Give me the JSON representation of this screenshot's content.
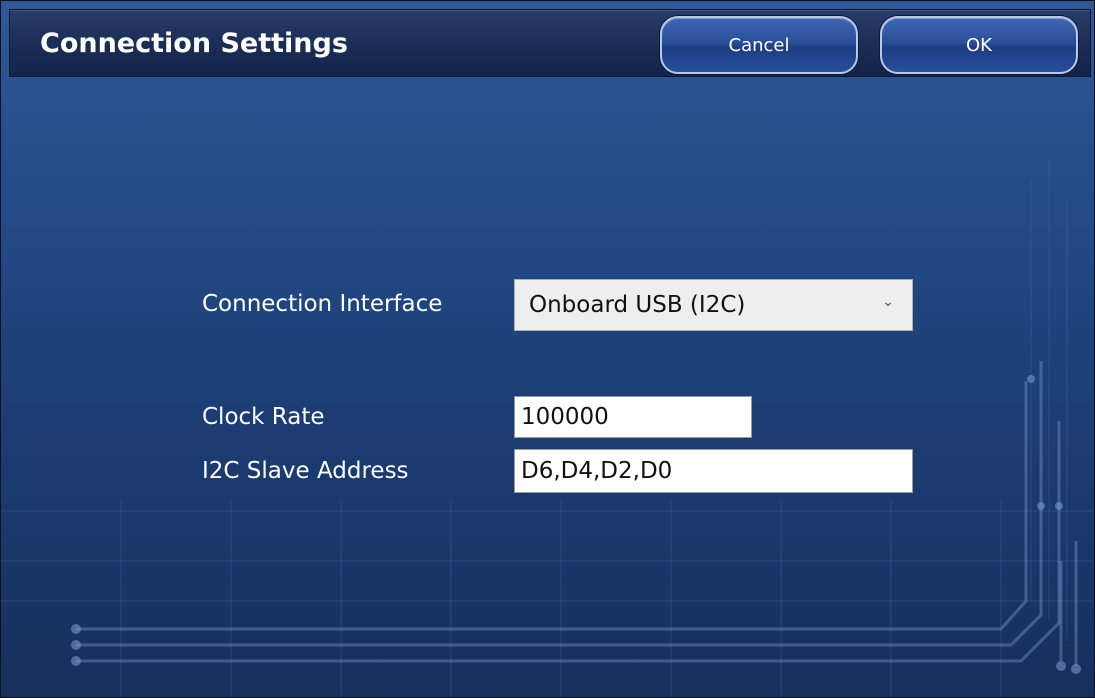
{
  "window": {
    "title": "Connection Settings",
    "cancel_label": "Cancel",
    "ok_label": "OK"
  },
  "form": {
    "interface_label": "Connection Interface",
    "interface_value": "Onboard USB (I2C)",
    "clock_label": "Clock Rate",
    "clock_value": "100000",
    "address_label": "I2C Slave Address",
    "address_value": "D6,D4,D2,D0"
  },
  "icons": {
    "dropdown": "chevron-down-icon"
  },
  "colors": {
    "background_top": "#2f5896",
    "background_bottom": "#172f5d",
    "titlebar": "#1b2e56",
    "button": "#2a4f99"
  }
}
